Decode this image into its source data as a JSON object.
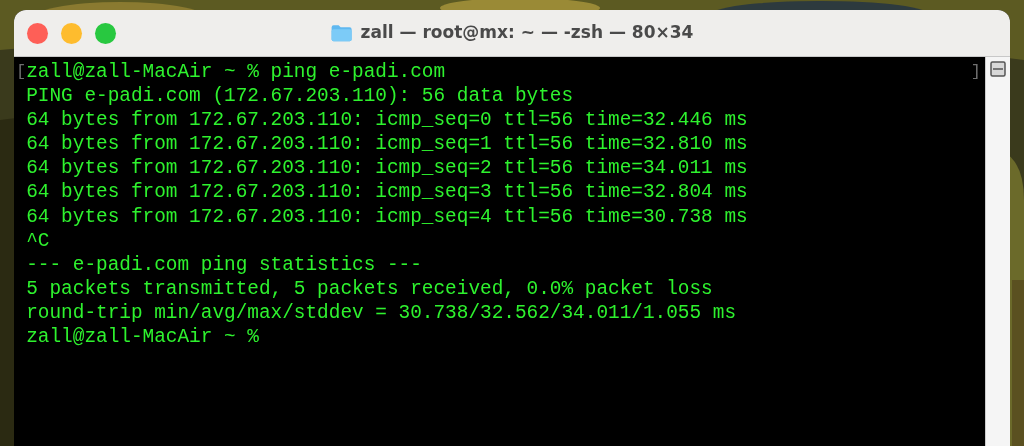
{
  "window": {
    "title": "zall — root@mx: ~ — -zsh — 80×34"
  },
  "terminal": {
    "marks": [
      "[",
      "]"
    ],
    "lines": [
      "zall@zall-MacAir ~ % ping e-padi.com",
      "PING e-padi.com (172.67.203.110): 56 data bytes",
      "64 bytes from 172.67.203.110: icmp_seq=0 ttl=56 time=32.446 ms",
      "64 bytes from 172.67.203.110: icmp_seq=1 ttl=56 time=32.810 ms",
      "64 bytes from 172.67.203.110: icmp_seq=2 ttl=56 time=34.011 ms",
      "64 bytes from 172.67.203.110: icmp_seq=3 ttl=56 time=32.804 ms",
      "64 bytes from 172.67.203.110: icmp_seq=4 ttl=56 time=30.738 ms",
      "^C",
      "--- e-padi.com ping statistics ---",
      "5 packets transmitted, 5 packets received, 0.0% packet loss",
      "round-trip min/avg/max/stddev = 30.738/32.562/34.011/1.055 ms",
      "zall@zall-MacAir ~ %"
    ]
  }
}
